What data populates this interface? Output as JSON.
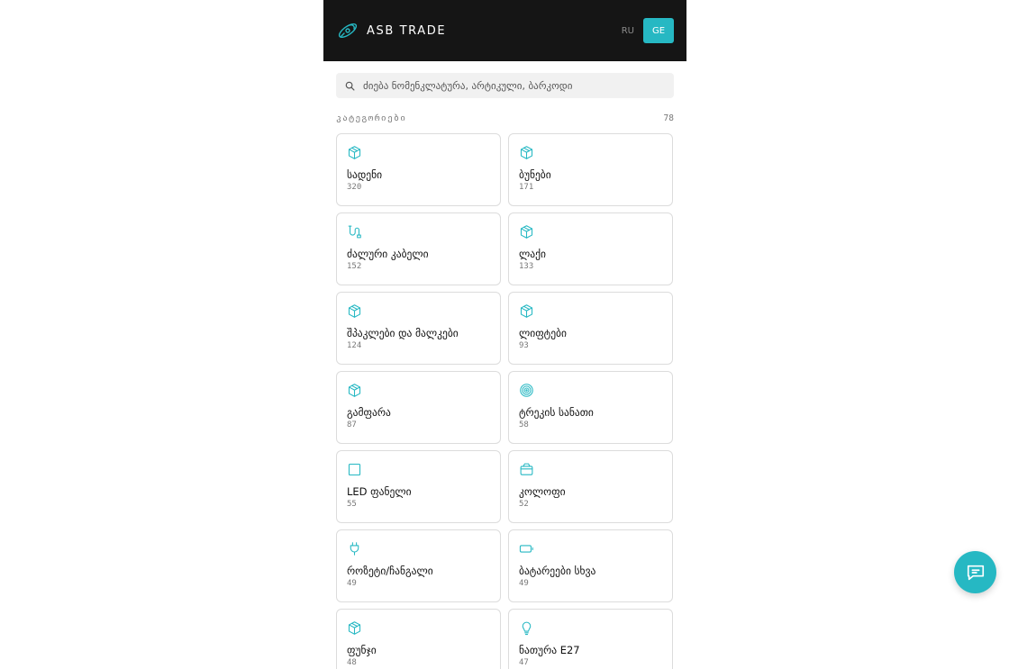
{
  "colors": {
    "accent": "#26b8c3",
    "header_bg": "#151515",
    "card_border": "#dcdcdc"
  },
  "header": {
    "brand": "ASB TRADE",
    "lang_ru": "RU",
    "lang_ge": "GE",
    "logo_icon": "satellite-logo"
  },
  "search": {
    "placeholder": "ძიება ნომენკლატურა, არტიკული, ბარკოდი",
    "icon": "search-icon"
  },
  "categories": {
    "title": "კატეგორიები",
    "count": "78",
    "items": [
      {
        "name": "სადენი",
        "count": "320",
        "icon": "box-icon"
      },
      {
        "name": "ბუნები",
        "count": "171",
        "icon": "box-icon"
      },
      {
        "name": "ძალური კაბელი",
        "count": "152",
        "icon": "cable-icon"
      },
      {
        "name": "ლაქი",
        "count": "133",
        "icon": "box-icon"
      },
      {
        "name": "შპაკლები და მალკები",
        "count": "124",
        "icon": "box-icon"
      },
      {
        "name": "ლიფტები",
        "count": "93",
        "icon": "box-icon"
      },
      {
        "name": "გამფარა",
        "count": "87",
        "icon": "box-icon"
      },
      {
        "name": "ტრეკის სანათი",
        "count": "58",
        "icon": "target-icon"
      },
      {
        "name": "LED ფანელი",
        "count": "55",
        "icon": "square-icon"
      },
      {
        "name": "კოლოფი",
        "count": "52",
        "icon": "package-icon"
      },
      {
        "name": "როზეტი/ჩანგალი",
        "count": "49",
        "icon": "plug-icon"
      },
      {
        "name": "ბატარეები სხვა",
        "count": "49",
        "icon": "battery-icon"
      },
      {
        "name": "ფუნჯი",
        "count": "48",
        "icon": "box-icon"
      },
      {
        "name": "ნათურა E27",
        "count": "47",
        "icon": "bulb-icon"
      }
    ]
  },
  "chat": {
    "icon": "chat-icon"
  }
}
